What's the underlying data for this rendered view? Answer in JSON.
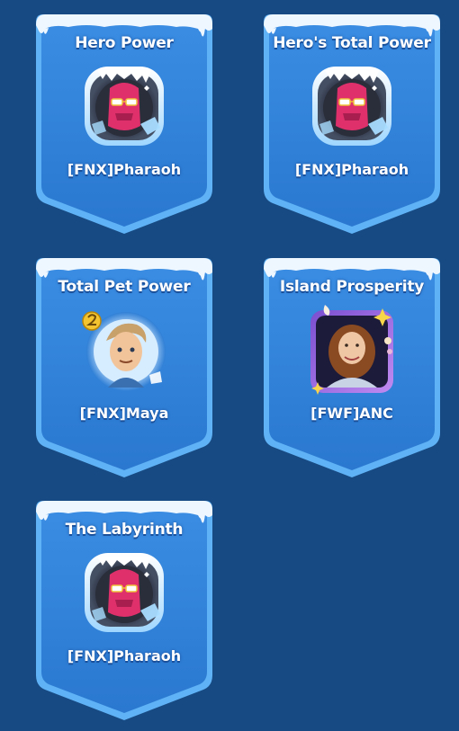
{
  "cards": [
    {
      "title": "Hero Power",
      "player": "[FNX]Pharaoh",
      "avatar": "ice-frame-masked-hero-avatar"
    },
    {
      "title": "Hero's Total Power",
      "player": "[FNX]Pharaoh",
      "avatar": "ice-frame-masked-hero-avatar"
    },
    {
      "title": "Total Pet Power",
      "player": "[FNX]Maya",
      "avatar": "cartoon-hero-avatar-rank-2"
    },
    {
      "title": "Island Prosperity",
      "player": "[FWF]ANC",
      "avatar": "player-photo-avatar-purple-frame"
    },
    {
      "title": "The Labyrinth",
      "player": "[FNX]Pharaoh",
      "avatar": "ice-frame-masked-hero-avatar"
    }
  ],
  "colors": {
    "background": "#174a82",
    "banner": "#2e82da",
    "banner_border": "#6fb8f5",
    "snow": "#eef6ff"
  }
}
